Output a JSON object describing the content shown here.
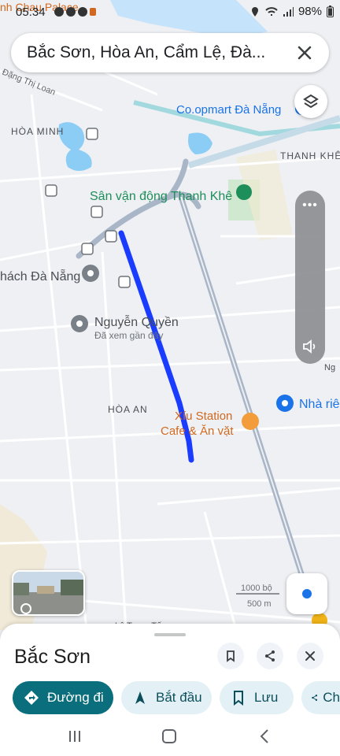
{
  "status_bar": {
    "time": "05:34",
    "battery": "98%"
  },
  "search": {
    "query": "Bắc Sơn, Hòa An, Cẩm Lệ, Đà..."
  },
  "map": {
    "labels": {
      "top_place": "nh Chau Palace",
      "street_loan": "Đặng Thị Loan",
      "hoa_minh": "HÒA MINH",
      "coopmart": "Co.opmart Đà Nẵng",
      "thanh_khe": "THANH KHÊ",
      "stadium": "Sân vận động Thanh Khê",
      "khach": "hách Đà Nẵng",
      "nguyen_quyen": "Nguyễn Quyền",
      "nguyen_quyen_sub": "Đã xem gần đây",
      "hoa_an": "HÒA AN",
      "xiu_1": "Xíu Station",
      "xiu_2": "Cafe & Ăn vặt",
      "nha_rieng": "Nhà riê",
      "scale_ft": "1000 bộ",
      "scale_m": "500 m",
      "le_trong_tan": "Lê Trọng Tấn",
      "street_right": "Ng"
    },
    "colors": {
      "route": "#1a3cff",
      "road_major": "#a9b6c8",
      "place_teal": "#1a7f8e",
      "place_orange": "#e07b1f",
      "place_blue": "#1a73e8"
    }
  },
  "bottom_sheet": {
    "title": "Bắc Sơn",
    "actions": [
      {
        "label": "Đường đi",
        "icon": "directions-icon"
      },
      {
        "label": "Bắt đầu",
        "icon": "navigation-arrow-icon"
      },
      {
        "label": "Lưu",
        "icon": "bookmark-icon"
      },
      {
        "label": "Ch",
        "icon": "share-icon"
      }
    ]
  }
}
